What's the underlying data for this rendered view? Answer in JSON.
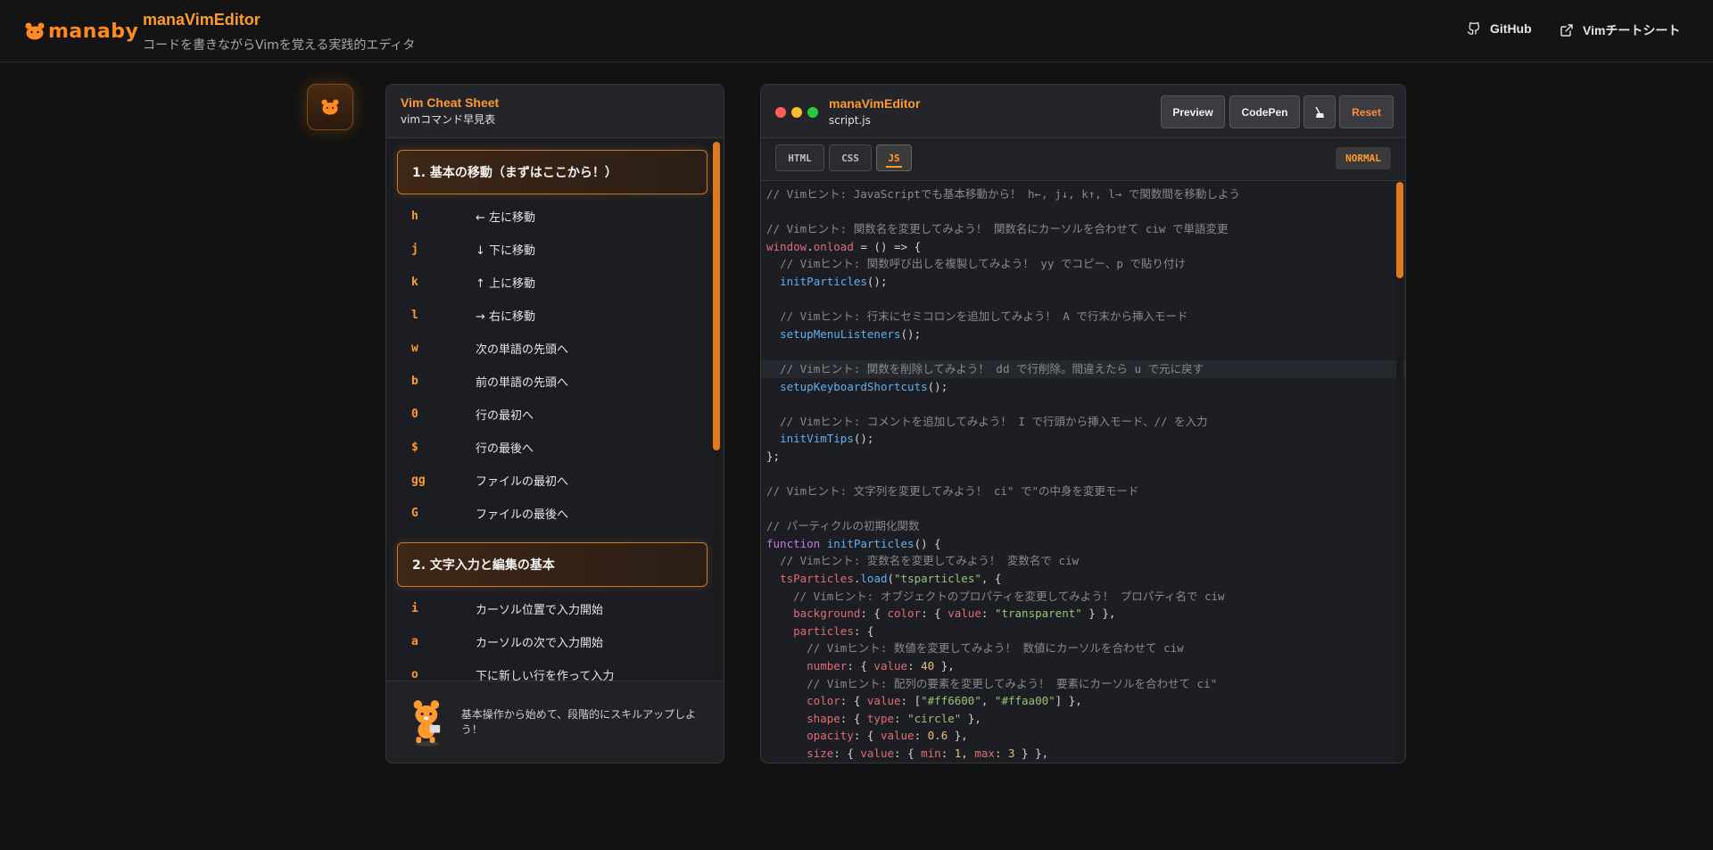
{
  "header": {
    "logo_text": "manaby",
    "title": "manaVimEditor",
    "subtitle": "コードを書きながらVimを覚える実践的エディタ",
    "links": [
      {
        "label": "GitHub",
        "icon": "github-icon"
      },
      {
        "label": "Vimチートシート",
        "icon": "external-link-icon"
      }
    ]
  },
  "cheat": {
    "title": "Vim Cheat Sheet",
    "subtitle": "vimコマンド早見表",
    "sections": [
      {
        "title": "1. 基本の移動（まずはここから！）",
        "commands": [
          {
            "key": "h",
            "desc": "← 左に移動"
          },
          {
            "key": "j",
            "desc": "↓ 下に移動"
          },
          {
            "key": "k",
            "desc": "↑ 上に移動"
          },
          {
            "key": "l",
            "desc": "→ 右に移動"
          },
          {
            "key": "w",
            "desc": "次の単語の先頭へ"
          },
          {
            "key": "b",
            "desc": "前の単語の先頭へ"
          },
          {
            "key": "0",
            "desc": "行の最初へ"
          },
          {
            "key": "$",
            "desc": "行の最後へ"
          },
          {
            "key": "gg",
            "desc": "ファイルの最初へ"
          },
          {
            "key": "G",
            "desc": "ファイルの最後へ"
          }
        ]
      },
      {
        "title": "2. 文字入力と編集の基本",
        "commands": [
          {
            "key": "i",
            "desc": "カーソル位置で入力開始"
          },
          {
            "key": "a",
            "desc": "カーソルの次で入力開始"
          },
          {
            "key": "o",
            "desc": "下に新しい行を作って入力"
          }
        ]
      }
    ],
    "footer_text": "基本操作から始めて、段階的にスキルアップしよう！"
  },
  "editor": {
    "title": "manaVimEditor",
    "file": "script.js",
    "buttons": {
      "preview": "Preview",
      "codepen": "CodePen",
      "theme_icon": "broom-icon",
      "reset": "Reset"
    },
    "tabs": [
      "HTML",
      "CSS",
      "JS"
    ],
    "active_tab": "JS",
    "mode": "NORMAL"
  },
  "colors": {
    "accent": "#ff9a30",
    "reset": "#ff8a3d",
    "dot_red": "#ff5f57",
    "dot_yellow": "#febc2e",
    "dot_green": "#28c840"
  }
}
